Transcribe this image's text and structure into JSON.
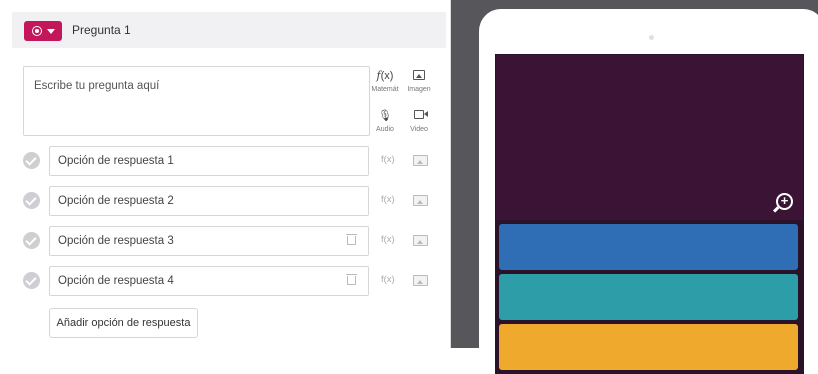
{
  "question": {
    "title": "Pregunta 1",
    "placeholder": "Escribe tu pregunta aquí",
    "type_icon": "radio-icon",
    "accent_color": "#c2185b"
  },
  "tools": {
    "math_label": "Matemát",
    "image_label": "Imagen",
    "audio_label": "Audio",
    "video_label": "Video",
    "fx_glyph": "f(x)"
  },
  "answers": [
    {
      "label": "Opción de respuesta 1",
      "deletable": false
    },
    {
      "label": "Opción de respuesta 2",
      "deletable": false
    },
    {
      "label": "Opción de respuesta 3",
      "deletable": true
    },
    {
      "label": "Opción de respuesta 4",
      "deletable": true
    }
  ],
  "add_option_label": "Añadir opción de respuesta",
  "preview": {
    "screen_color": "#3b1435",
    "option_colors": [
      "#2f6db5",
      "#2d9ea8",
      "#efaa2e"
    ]
  }
}
